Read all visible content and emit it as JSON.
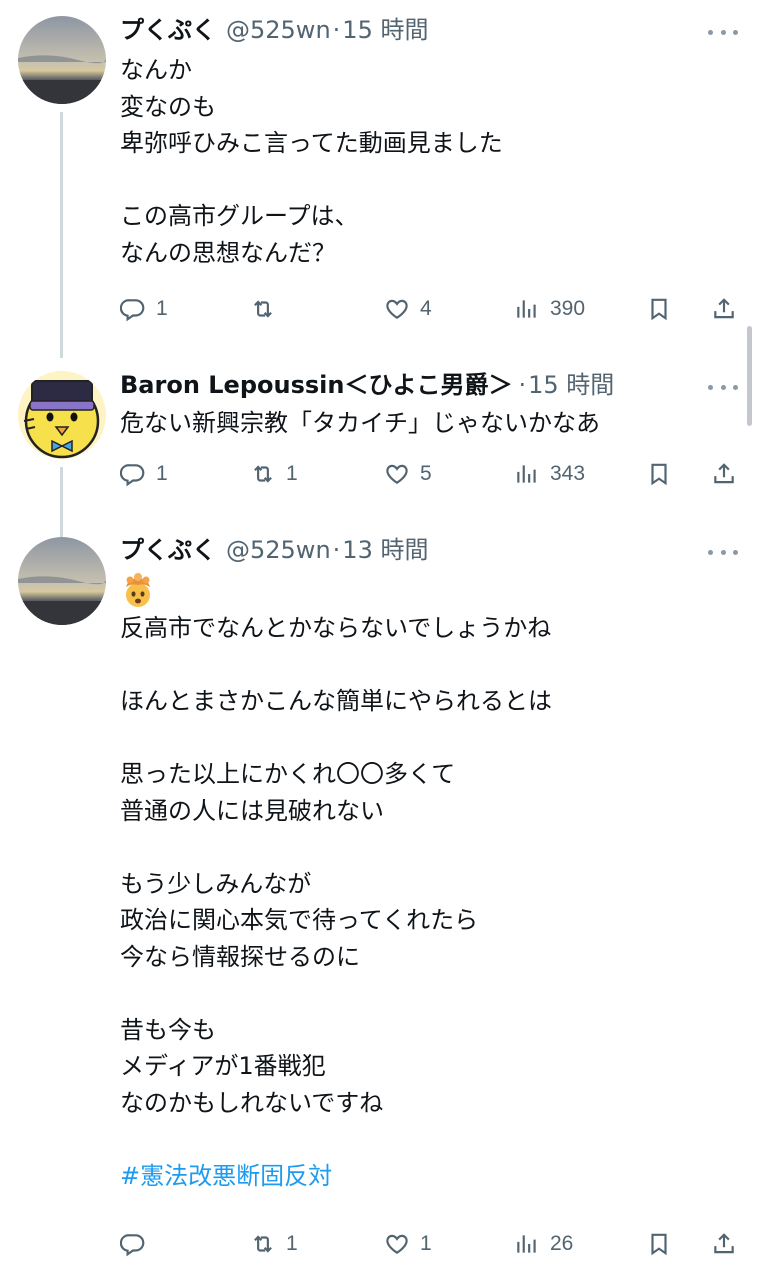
{
  "tweets": [
    {
      "name": "プくぷく",
      "handle": "@525wn",
      "dot": "·",
      "time": "15 時間",
      "lines": [
        "なんか",
        "変なのも",
        "卑弥呼ひみこ言ってた動画見ました",
        "",
        "この高市グループは、",
        "なんの思想なんだ？"
      ],
      "reply_count": "1",
      "retweet_count": "",
      "like_count": "4",
      "view_count": "390"
    },
    {
      "name": "Baron Lepoussin＜ひよこ男爵＞",
      "handle": "",
      "dot": "·",
      "time": "15 時間",
      "lines": [
        "危ない新興宗教「タカイチ」じゃないかなあ"
      ],
      "reply_count": "1",
      "retweet_count": "1",
      "like_count": "5",
      "view_count": "343"
    },
    {
      "name": "プくぷく",
      "handle": "@525wn",
      "dot": "·",
      "time": "13 時間",
      "emoji": "exploding-head",
      "lines": [
        "反高市でなんとかならないでしょうかね",
        "",
        "ほんとまさかこんな簡単にやられるとは",
        "",
        "思った以上にかくれ〇〇多くて",
        "普通の人には見破れない",
        "",
        "もう少しみんなが",
        "政治に関心本気で待ってくれたら",
        "今なら情報探せるのに",
        "",
        "昔も今も",
        "メディアが1番戦犯",
        "なのかもしれないですね",
        ""
      ],
      "hashtag": "#憲法改悪断固反対",
      "reply_count": "",
      "retweet_count": "1",
      "like_count": "1",
      "view_count": "26"
    }
  ],
  "icons": {
    "reply": "reply-icon",
    "retweet": "retweet-icon",
    "like": "heart-icon",
    "views": "views-chart-icon",
    "bookmark": "bookmark-icon",
    "share": "share-icon",
    "more": "more-options-icon"
  },
  "colors": {
    "text": "#0f1419",
    "secondary": "#536471",
    "hashtag": "#1d9bf0",
    "thread_line": "#cfd9de"
  }
}
